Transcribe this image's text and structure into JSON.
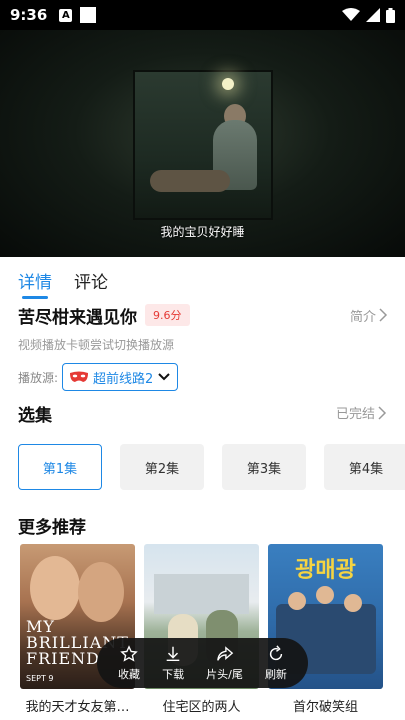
{
  "status_bar": {
    "time": "9:36",
    "notification_letter": "A"
  },
  "video": {
    "subtitle": "我的宝贝好好睡"
  },
  "tabs": [
    {
      "label": "详情",
      "active": true
    },
    {
      "label": "评论",
      "active": false
    }
  ],
  "details": {
    "title": "苦尽柑来遇见你",
    "rating": "9.6分",
    "intro_label": "简介",
    "tip": "视频播放卡顿尝试切换播放源",
    "source_label": "播放源:",
    "source_selected": "超前线路2"
  },
  "episodes": {
    "section_title": "选集",
    "status": "已完结",
    "items": [
      {
        "label": "第1集",
        "active": true
      },
      {
        "label": "第2集",
        "active": false
      },
      {
        "label": "第3集",
        "active": false
      },
      {
        "label": "第4集",
        "active": false
      }
    ]
  },
  "recommendations": {
    "section_title": "更多推荐",
    "items": [
      {
        "title": "我的天才女友第…",
        "poster_text": "MY BRILLIANT FRIEND",
        "poster_date": "SEPT 9"
      },
      {
        "title": "住宅区的两人"
      },
      {
        "title": "首尔破笑组",
        "poster_text": "광매광"
      }
    ]
  },
  "float_bar": {
    "favorite": "收藏",
    "download": "下载",
    "skip": "片头/尾",
    "refresh": "刷新"
  },
  "colors": {
    "accent": "#1e88e5",
    "rating": "#e53935"
  }
}
